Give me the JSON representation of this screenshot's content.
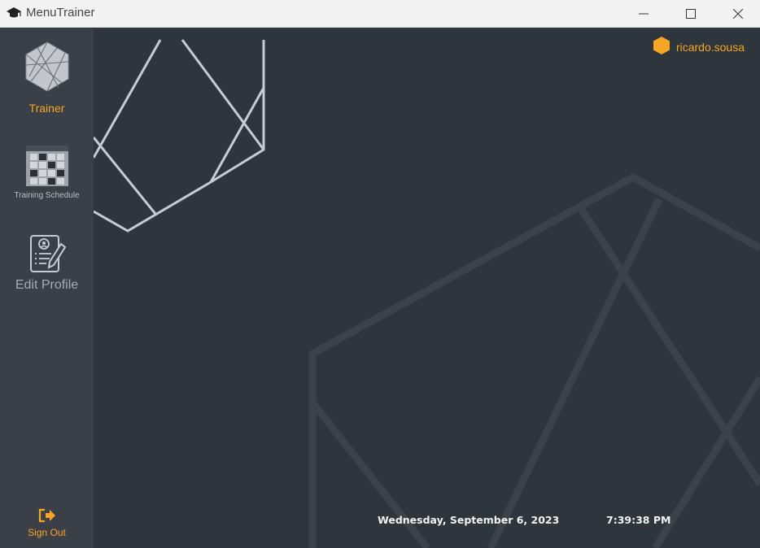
{
  "window": {
    "title": "MenuTrainer"
  },
  "sidebar": {
    "items": [
      {
        "label": "Trainer",
        "icon": "hexagon-logo-icon",
        "active": true
      },
      {
        "label": "Training Schedule",
        "icon": "calendar-grid-icon"
      },
      {
        "label": "Edit Profile",
        "icon": "edit-profile-icon"
      }
    ],
    "sign_out": {
      "label": "Sign Out",
      "icon": "sign-out-icon"
    }
  },
  "header": {
    "username": "ricardo.sousa",
    "user_icon": "hexagon-user-icon"
  },
  "footer": {
    "date": "Wednesday, September 6, 2023",
    "time": "7:39:38 PM"
  },
  "colors": {
    "accent": "#f5a623",
    "background": "#2f353d",
    "sidebar": "#3b4048",
    "pattern_light": "#c8ccd2",
    "pattern_dark": "#3c424a"
  }
}
